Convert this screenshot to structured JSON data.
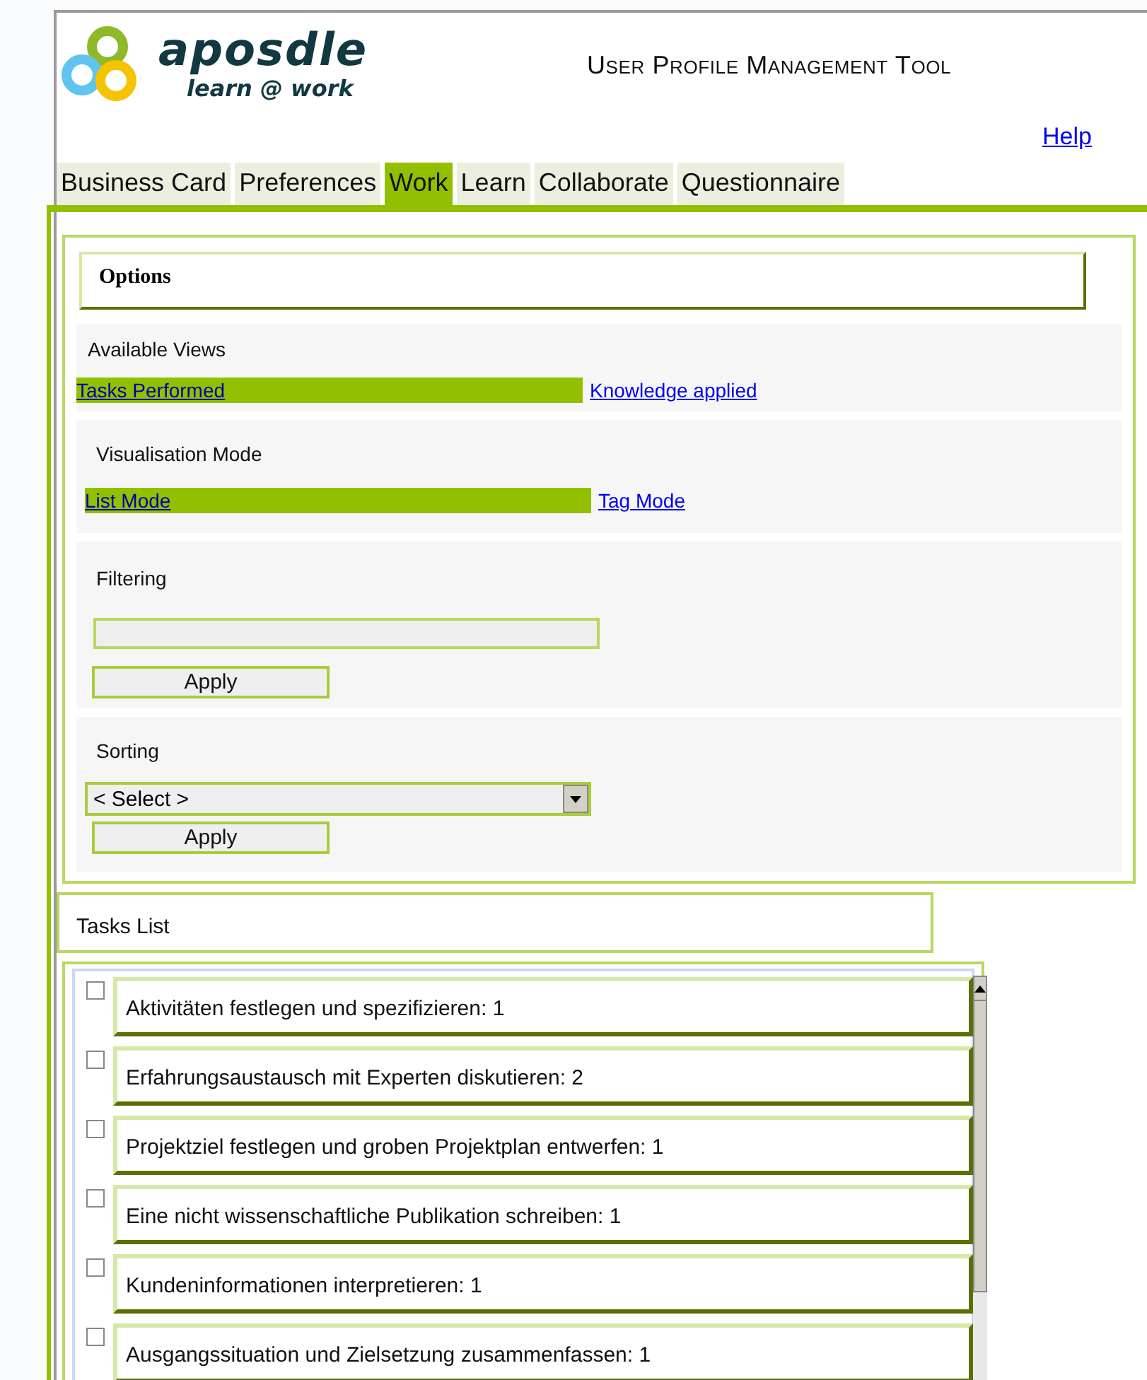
{
  "header": {
    "logo_name": "aposdle",
    "logo_tagline": "learn @ work",
    "title": "User Profile Management Tool",
    "help_link": "Help"
  },
  "tabs": [
    {
      "label": "Business Card",
      "selected": false
    },
    {
      "label": "Preferences",
      "selected": false
    },
    {
      "label": "Work",
      "selected": true
    },
    {
      "label": "Learn",
      "selected": false
    },
    {
      "label": "Collaborate",
      "selected": false
    },
    {
      "label": "Questionnaire",
      "selected": false
    }
  ],
  "options": {
    "title": "Options",
    "available_views": {
      "label": "Available Views",
      "links": [
        {
          "label": "Tasks Performed",
          "selected": true
        },
        {
          "label": "Knowledge applied",
          "selected": false
        }
      ]
    },
    "visualisation_mode": {
      "label": "Visualisation Mode",
      "links": [
        {
          "label": "List Mode",
          "selected": true
        },
        {
          "label": "Tag Mode",
          "selected": false
        }
      ]
    },
    "filtering": {
      "label": "Filtering",
      "apply_button": "Apply"
    },
    "sorting": {
      "label": "Sorting",
      "select_value": "< Select >",
      "apply_button": "Apply"
    }
  },
  "tasks_list": {
    "title": "Tasks List",
    "items": [
      {
        "label": "Aktivitäten festlegen und spezifizieren: 1",
        "checked": false
      },
      {
        "label": "Erfahrungsaustausch mit Experten diskutieren: 2",
        "checked": false
      },
      {
        "label": "Projektziel festlegen und groben Projektplan entwerfen: 1",
        "checked": false
      },
      {
        "label": "Eine nicht wissenschaftliche Publikation schreiben: 1",
        "checked": false
      },
      {
        "label": "Kundeninformationen interpretieren: 1",
        "checked": false
      },
      {
        "label": "Ausgangssituation und Zielsetzung zusammenfassen: 1",
        "checked": false
      }
    ]
  }
}
